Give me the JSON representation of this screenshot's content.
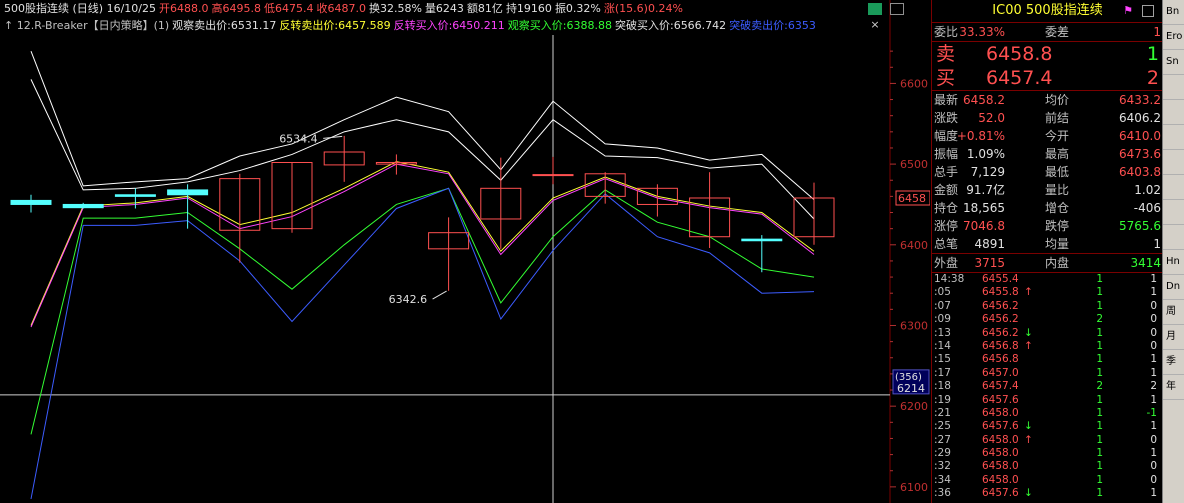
{
  "header": {
    "line1": [
      {
        "text": "500股指连续 (日线) 16/10/25",
        "color": "#e0e0e0"
      },
      {
        "text": "开6488.0",
        "color": "#ff5050"
      },
      {
        "text": "高6495.8",
        "color": "#ff5050"
      },
      {
        "text": "低6475.4",
        "color": "#ff5050"
      },
      {
        "text": "收6487.0",
        "color": "#ff5050"
      },
      {
        "text": "换32.58%",
        "color": "#e0e0e0"
      },
      {
        "text": "量6243",
        "color": "#e0e0e0"
      },
      {
        "text": "额81亿",
        "color": "#e0e0e0"
      },
      {
        "text": "持19160",
        "color": "#e0e0e0"
      },
      {
        "text": "振0.32%",
        "color": "#e0e0e0"
      },
      {
        "text": "涨(15.6)0.24%",
        "color": "#ff5050"
      }
    ],
    "line2": [
      {
        "text": "↑ 12.R-Breaker【日内策略】(1)",
        "color": "#c0c0c0"
      },
      {
        "text": "观察卖出价:6531.17",
        "color": "#e0e0e0"
      },
      {
        "text": "反转卖出价:6457.589",
        "color": "#ffff33"
      },
      {
        "text": "反转买入价:6450.211",
        "color": "#ff44ff"
      },
      {
        "text": "观察买入价:6388.88",
        "color": "#33ff33"
      },
      {
        "text": "突破买入价:6566.742",
        "color": "#e0e0e0"
      },
      {
        "text": "突破卖出价:6353",
        "color": "#3c5cff"
      }
    ]
  },
  "chart_data": {
    "type": "candlestick",
    "ylim": [
      6080,
      6660
    ],
    "y_ticks": [
      6100,
      6200,
      6300,
      6400,
      6500,
      6600
    ],
    "candles": [
      {
        "o": 6455,
        "h": 6462,
        "l": 6440,
        "c": 6450
      },
      {
        "o": 6450,
        "h": 6452,
        "l": 6445,
        "c": 6446
      },
      {
        "o": 6462,
        "h": 6470,
        "l": 6445,
        "c": 6460
      },
      {
        "o": 6468,
        "h": 6475,
        "l": 6420,
        "c": 6462
      },
      {
        "o": 6418,
        "h": 6488,
        "l": 6378,
        "c": 6482
      },
      {
        "o": 6420,
        "h": 6502,
        "l": 6415,
        "c": 6502
      },
      {
        "o": 6499,
        "h": 6535,
        "l": 6478,
        "c": 6515
      },
      {
        "o": 6500,
        "h": 6512,
        "l": 6487,
        "c": 6502
      },
      {
        "o": 6395,
        "h": 6434,
        "l": 6343,
        "c": 6415
      },
      {
        "o": 6432,
        "h": 6508,
        "l": 6395,
        "c": 6470
      },
      {
        "o": 6487,
        "h": 6509,
        "l": 6475,
        "c": 6487
      },
      {
        "o": 6460,
        "h": 6490,
        "l": 6451,
        "c": 6488
      },
      {
        "o": 6450,
        "h": 6475,
        "l": 6435,
        "c": 6470
      },
      {
        "o": 6410,
        "h": 6490,
        "l": 6396,
        "c": 6458
      },
      {
        "o": 6407,
        "h": 6412,
        "l": 6366,
        "c": 6405
      },
      {
        "o": 6410,
        "h": 6477,
        "l": 6400,
        "c": 6458
      }
    ],
    "series": [
      {
        "name": "观察卖出价",
        "color": "#ffffff",
        "values": [
          6640,
          6473,
          6478,
          6482,
          6510,
          6525,
          6555,
          6583,
          6565,
          6493,
          6578,
          6525,
          6520,
          6505,
          6512,
          6456
        ]
      },
      {
        "name": "突破买入价",
        "color": "#ffffff",
        "values": [
          6605,
          6468,
          6470,
          6478,
          6492,
          6512,
          6540,
          6555,
          6540,
          6480,
          6555,
          6510,
          6508,
          6495,
          6500,
          6432
        ]
      },
      {
        "name": "反转卖出价",
        "color": "#ffff33",
        "values": [
          6300,
          6448,
          6452,
          6460,
          6425,
          6440,
          6470,
          6503,
          6490,
          6392,
          6458,
          6484,
          6460,
          6448,
          6440,
          6392
        ]
      },
      {
        "name": "反转买入价",
        "color": "#ff44ff",
        "values": [
          6298,
          6446,
          6450,
          6458,
          6420,
          6435,
          6466,
          6500,
          6488,
          6388,
          6455,
          6482,
          6458,
          6446,
          6438,
          6388
        ]
      },
      {
        "name": "观察买入价",
        "color": "#33ff33",
        "values": [
          6165,
          6433,
          6433,
          6440,
          6395,
          6345,
          6400,
          6450,
          6470,
          6328,
          6410,
          6468,
          6428,
          6410,
          6370,
          6360
        ]
      },
      {
        "name": "突破卖出价",
        "color": "#3c5cff",
        "values": [
          6085,
          6424,
          6424,
          6430,
          6380,
          6305,
          6375,
          6445,
          6470,
          6308,
          6393,
          6463,
          6410,
          6390,
          6340,
          6342
        ]
      }
    ],
    "annotations": [
      {
        "text": "6534.4",
        "candle": 6,
        "value": 6534.4
      },
      {
        "text": "6342.6",
        "candle": 8,
        "value": 6342.6
      }
    ],
    "current_price_label": "6458",
    "crosshair": {
      "value_label": "6214",
      "count_label": "(356)",
      "price": 6214,
      "candle": 10
    }
  },
  "quote": {
    "code": "IC00",
    "name": "500股指连续",
    "weibi_label": "委比",
    "weibi_value": "33.33%",
    "weicha_label": "委差",
    "weicha_value": "1",
    "sell_label": "卖",
    "sell_price": "6458.8",
    "sell_vol": "1",
    "buy_label": "买",
    "buy_price": "6457.4",
    "buy_vol": "2",
    "stats": [
      {
        "l1": "最新",
        "v1": "6458.2",
        "c1": "#ff5050",
        "l2": "均价",
        "v2": "6433.2",
        "c2": "#ff5050"
      },
      {
        "l1": "涨跌",
        "v1": "52.0",
        "c1": "#ff5050",
        "l2": "前结",
        "v2": "6406.2",
        "c2": "#e0e0e0"
      },
      {
        "l1": "幅度",
        "v1": "+0.81%",
        "c1": "#ff5050",
        "l2": "今开",
        "v2": "6410.0",
        "c2": "#ff5050"
      },
      {
        "l1": "振幅",
        "v1": "1.09%",
        "c1": "#e0e0e0",
        "l2": "最高",
        "v2": "6473.6",
        "c2": "#ff5050"
      },
      {
        "l1": "总手",
        "v1": "7,129",
        "c1": "#e0e0e0",
        "l2": "最低",
        "v2": "6403.8",
        "c2": "#ff5050"
      },
      {
        "l1": "金额",
        "v1": "91.7亿",
        "c1": "#e0e0e0",
        "l2": "量比",
        "v2": "1.02",
        "c2": "#e0e0e0"
      },
      {
        "l1": "持仓",
        "v1": "18,565",
        "c1": "#e0e0e0",
        "l2": "增仓",
        "v2": "-406",
        "c2": "#e0e0e0"
      },
      {
        "l1": "涨停",
        "v1": "7046.8",
        "c1": "#ff5050",
        "l2": "跌停",
        "v2": "5765.6",
        "c2": "#33ff33"
      },
      {
        "l1": "总笔",
        "v1": "4891",
        "c1": "#e0e0e0",
        "l2": "均量",
        "v2": "1",
        "c2": "#e0e0e0"
      }
    ],
    "waipan_label": "外盘",
    "waipan_value": "3715",
    "neipan_label": "内盘",
    "neipan_value": "3414",
    "ticks": [
      {
        "t": "14:38",
        "p": "6455.4",
        "a": "",
        "v": "1",
        "n": "1"
      },
      {
        "t": ":05",
        "p": "6455.8",
        "a": "↑",
        "v": "1",
        "n": "1"
      },
      {
        "t": ":07",
        "p": "6456.2",
        "a": "",
        "v": "1",
        "n": "0"
      },
      {
        "t": ":09",
        "p": "6456.2",
        "a": "",
        "v": "2",
        "n": "0"
      },
      {
        "t": ":13",
        "p": "6456.2",
        "a": "↓",
        "v": "1",
        "n": "0"
      },
      {
        "t": ":14",
        "p": "6456.8",
        "a": "↑",
        "v": "1",
        "n": "0"
      },
      {
        "t": ":15",
        "p": "6456.8",
        "a": "",
        "v": "1",
        "n": "1"
      },
      {
        "t": ":17",
        "p": "6457.0",
        "a": "",
        "v": "1",
        "n": "1"
      },
      {
        "t": ":18",
        "p": "6457.4",
        "a": "",
        "v": "2",
        "n": "2"
      },
      {
        "t": ":19",
        "p": "6457.6",
        "a": "",
        "v": "1",
        "n": "1"
      },
      {
        "t": ":21",
        "p": "6458.0",
        "a": "",
        "v": "1",
        "n": "-1"
      },
      {
        "t": ":25",
        "p": "6457.6",
        "a": "↓",
        "v": "1",
        "n": "1"
      },
      {
        "t": ":27",
        "p": "6458.0",
        "a": "↑",
        "v": "1",
        "n": "0"
      },
      {
        "t": ":29",
        "p": "6458.0",
        "a": "",
        "v": "1",
        "n": "1"
      },
      {
        "t": ":32",
        "p": "6458.0",
        "a": "",
        "v": "1",
        "n": "0"
      },
      {
        "t": ":34",
        "p": "6458.0",
        "a": "",
        "v": "1",
        "n": "0"
      },
      {
        "t": ":36",
        "p": "6457.6",
        "a": "↓",
        "v": "1",
        "n": "1"
      }
    ]
  },
  "side_items": [
    "Bn",
    "Ero",
    "Sn",
    "",
    "",
    "",
    "",
    "",
    "",
    "",
    "Hn",
    "Dn",
    "周",
    "月",
    "季",
    "年"
  ]
}
